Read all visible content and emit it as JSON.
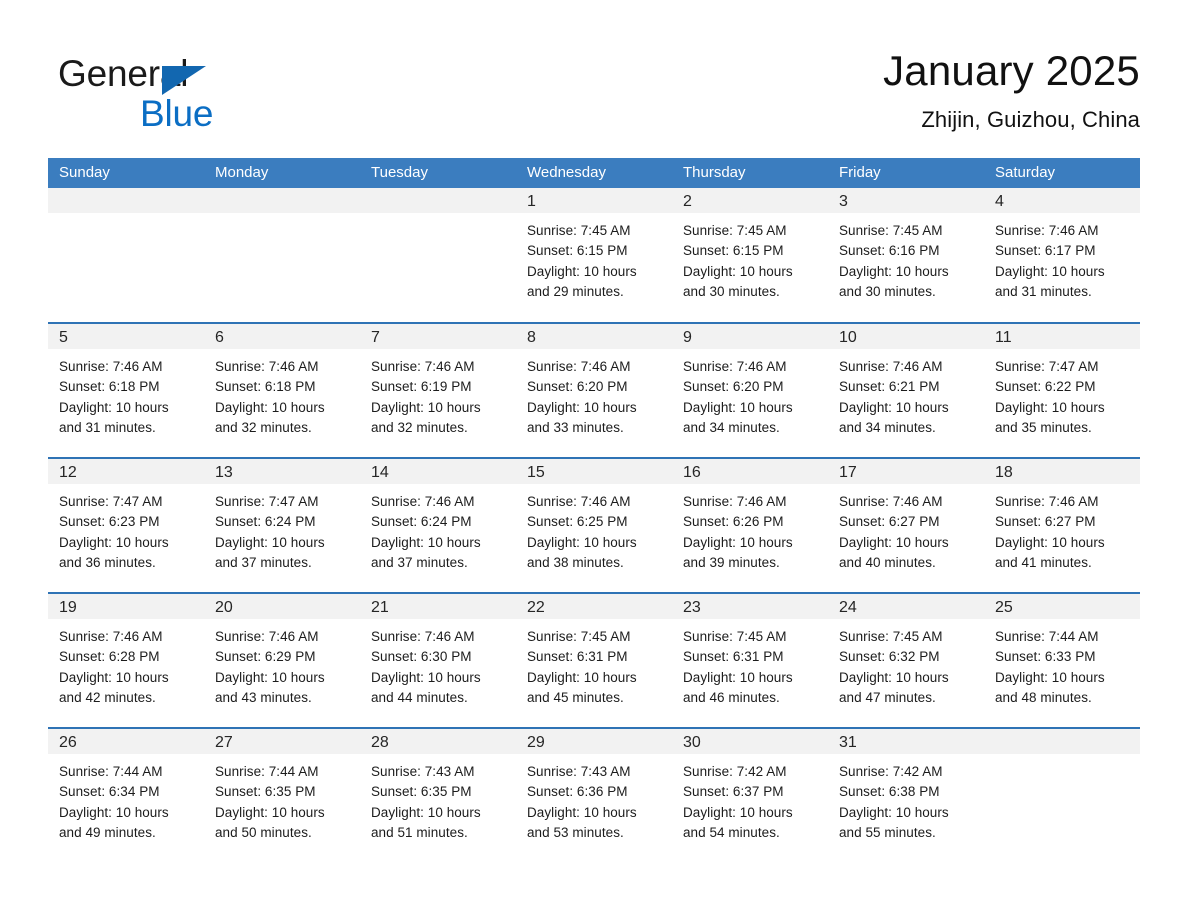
{
  "brand": {
    "name_part1": "General",
    "name_part2": "Blue",
    "triangle_color": "#1267b0",
    "blue_color": "#0b6ec4"
  },
  "header": {
    "title": "January 2025",
    "location": "Zhijin, Guizhou, China"
  },
  "theme": {
    "header_blue": "#3b7dbf",
    "row_divider_blue": "#2f73b5",
    "daynum_band": "#f2f2f2",
    "text": "#1c1c1c"
  },
  "weekdays": [
    "Sunday",
    "Monday",
    "Tuesday",
    "Wednesday",
    "Thursday",
    "Friday",
    "Saturday"
  ],
  "labels": {
    "sunrise_prefix": "Sunrise: ",
    "sunset_prefix": "Sunset: ",
    "daylight_prefix": "Daylight: "
  },
  "weeks": [
    [
      {
        "day": "",
        "l1": "",
        "l2": "",
        "l3": "",
        "l4": ""
      },
      {
        "day": "",
        "l1": "",
        "l2": "",
        "l3": "",
        "l4": ""
      },
      {
        "day": "",
        "l1": "",
        "l2": "",
        "l3": "",
        "l4": ""
      },
      {
        "day": "1",
        "l1": "Sunrise: 7:45 AM",
        "l2": "Sunset: 6:15 PM",
        "l3": "Daylight: 10 hours",
        "l4": "and 29 minutes."
      },
      {
        "day": "2",
        "l1": "Sunrise: 7:45 AM",
        "l2": "Sunset: 6:15 PM",
        "l3": "Daylight: 10 hours",
        "l4": "and 30 minutes."
      },
      {
        "day": "3",
        "l1": "Sunrise: 7:45 AM",
        "l2": "Sunset: 6:16 PM",
        "l3": "Daylight: 10 hours",
        "l4": "and 30 minutes."
      },
      {
        "day": "4",
        "l1": "Sunrise: 7:46 AM",
        "l2": "Sunset: 6:17 PM",
        "l3": "Daylight: 10 hours",
        "l4": "and 31 minutes."
      }
    ],
    [
      {
        "day": "5",
        "l1": "Sunrise: 7:46 AM",
        "l2": "Sunset: 6:18 PM",
        "l3": "Daylight: 10 hours",
        "l4": "and 31 minutes."
      },
      {
        "day": "6",
        "l1": "Sunrise: 7:46 AM",
        "l2": "Sunset: 6:18 PM",
        "l3": "Daylight: 10 hours",
        "l4": "and 32 minutes."
      },
      {
        "day": "7",
        "l1": "Sunrise: 7:46 AM",
        "l2": "Sunset: 6:19 PM",
        "l3": "Daylight: 10 hours",
        "l4": "and 32 minutes."
      },
      {
        "day": "8",
        "l1": "Sunrise: 7:46 AM",
        "l2": "Sunset: 6:20 PM",
        "l3": "Daylight: 10 hours",
        "l4": "and 33 minutes."
      },
      {
        "day": "9",
        "l1": "Sunrise: 7:46 AM",
        "l2": "Sunset: 6:20 PM",
        "l3": "Daylight: 10 hours",
        "l4": "and 34 minutes."
      },
      {
        "day": "10",
        "l1": "Sunrise: 7:46 AM",
        "l2": "Sunset: 6:21 PM",
        "l3": "Daylight: 10 hours",
        "l4": "and 34 minutes."
      },
      {
        "day": "11",
        "l1": "Sunrise: 7:47 AM",
        "l2": "Sunset: 6:22 PM",
        "l3": "Daylight: 10 hours",
        "l4": "and 35 minutes."
      }
    ],
    [
      {
        "day": "12",
        "l1": "Sunrise: 7:47 AM",
        "l2": "Sunset: 6:23 PM",
        "l3": "Daylight: 10 hours",
        "l4": "and 36 minutes."
      },
      {
        "day": "13",
        "l1": "Sunrise: 7:47 AM",
        "l2": "Sunset: 6:24 PM",
        "l3": "Daylight: 10 hours",
        "l4": "and 37 minutes."
      },
      {
        "day": "14",
        "l1": "Sunrise: 7:46 AM",
        "l2": "Sunset: 6:24 PM",
        "l3": "Daylight: 10 hours",
        "l4": "and 37 minutes."
      },
      {
        "day": "15",
        "l1": "Sunrise: 7:46 AM",
        "l2": "Sunset: 6:25 PM",
        "l3": "Daylight: 10 hours",
        "l4": "and 38 minutes."
      },
      {
        "day": "16",
        "l1": "Sunrise: 7:46 AM",
        "l2": "Sunset: 6:26 PM",
        "l3": "Daylight: 10 hours",
        "l4": "and 39 minutes."
      },
      {
        "day": "17",
        "l1": "Sunrise: 7:46 AM",
        "l2": "Sunset: 6:27 PM",
        "l3": "Daylight: 10 hours",
        "l4": "and 40 minutes."
      },
      {
        "day": "18",
        "l1": "Sunrise: 7:46 AM",
        "l2": "Sunset: 6:27 PM",
        "l3": "Daylight: 10 hours",
        "l4": "and 41 minutes."
      }
    ],
    [
      {
        "day": "19",
        "l1": "Sunrise: 7:46 AM",
        "l2": "Sunset: 6:28 PM",
        "l3": "Daylight: 10 hours",
        "l4": "and 42 minutes."
      },
      {
        "day": "20",
        "l1": "Sunrise: 7:46 AM",
        "l2": "Sunset: 6:29 PM",
        "l3": "Daylight: 10 hours",
        "l4": "and 43 minutes."
      },
      {
        "day": "21",
        "l1": "Sunrise: 7:46 AM",
        "l2": "Sunset: 6:30 PM",
        "l3": "Daylight: 10 hours",
        "l4": "and 44 minutes."
      },
      {
        "day": "22",
        "l1": "Sunrise: 7:45 AM",
        "l2": "Sunset: 6:31 PM",
        "l3": "Daylight: 10 hours",
        "l4": "and 45 minutes."
      },
      {
        "day": "23",
        "l1": "Sunrise: 7:45 AM",
        "l2": "Sunset: 6:31 PM",
        "l3": "Daylight: 10 hours",
        "l4": "and 46 minutes."
      },
      {
        "day": "24",
        "l1": "Sunrise: 7:45 AM",
        "l2": "Sunset: 6:32 PM",
        "l3": "Daylight: 10 hours",
        "l4": "and 47 minutes."
      },
      {
        "day": "25",
        "l1": "Sunrise: 7:44 AM",
        "l2": "Sunset: 6:33 PM",
        "l3": "Daylight: 10 hours",
        "l4": "and 48 minutes."
      }
    ],
    [
      {
        "day": "26",
        "l1": "Sunrise: 7:44 AM",
        "l2": "Sunset: 6:34 PM",
        "l3": "Daylight: 10 hours",
        "l4": "and 49 minutes."
      },
      {
        "day": "27",
        "l1": "Sunrise: 7:44 AM",
        "l2": "Sunset: 6:35 PM",
        "l3": "Daylight: 10 hours",
        "l4": "and 50 minutes."
      },
      {
        "day": "28",
        "l1": "Sunrise: 7:43 AM",
        "l2": "Sunset: 6:35 PM",
        "l3": "Daylight: 10 hours",
        "l4": "and 51 minutes."
      },
      {
        "day": "29",
        "l1": "Sunrise: 7:43 AM",
        "l2": "Sunset: 6:36 PM",
        "l3": "Daylight: 10 hours",
        "l4": "and 53 minutes."
      },
      {
        "day": "30",
        "l1": "Sunrise: 7:42 AM",
        "l2": "Sunset: 6:37 PM",
        "l3": "Daylight: 10 hours",
        "l4": "and 54 minutes."
      },
      {
        "day": "31",
        "l1": "Sunrise: 7:42 AM",
        "l2": "Sunset: 6:38 PM",
        "l3": "Daylight: 10 hours",
        "l4": "and 55 minutes."
      },
      {
        "day": "",
        "l1": "",
        "l2": "",
        "l3": "",
        "l4": ""
      }
    ]
  ]
}
